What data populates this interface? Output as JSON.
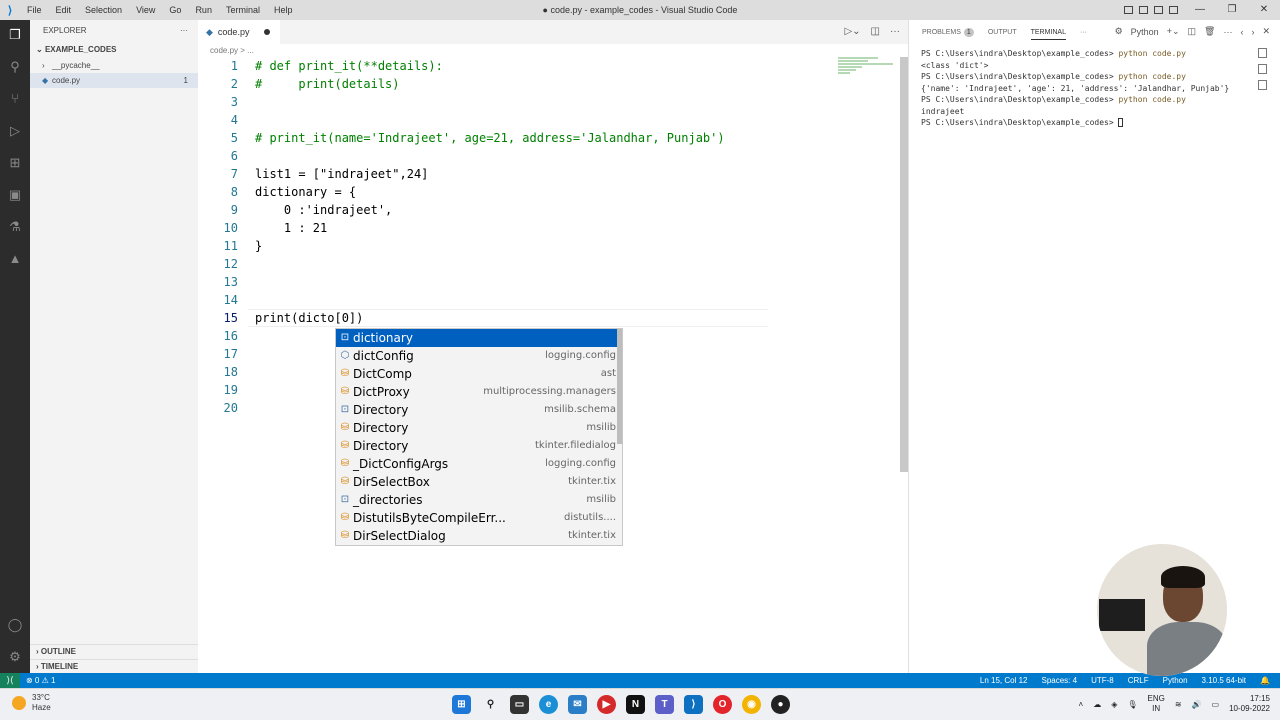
{
  "window": {
    "title": "● code.py - example_codes - Visual Studio Code",
    "menu": [
      "File",
      "Edit",
      "Selection",
      "View",
      "Go",
      "Run",
      "Terminal",
      "Help"
    ]
  },
  "sidebar": {
    "header": "EXPLORER",
    "folder": "EXAMPLE_CODES",
    "items": [
      {
        "label": "__pycache__",
        "type": "folder"
      },
      {
        "label": "code.py",
        "type": "file",
        "badge": "1"
      }
    ],
    "outline": "OUTLINE",
    "timeline": "TIMELINE"
  },
  "editor": {
    "tab": {
      "label": "code.py"
    },
    "breadcrumb": "code.py > ...",
    "lines": [
      {
        "n": "1",
        "t": "# def print_it(**details):"
      },
      {
        "n": "2",
        "t": "#     print(details)"
      },
      {
        "n": "3",
        "t": ""
      },
      {
        "n": "4",
        "t": ""
      },
      {
        "n": "5",
        "t": "# print_it(name='Indrajeet', age=21, address='Jalandhar, Punjab')"
      },
      {
        "n": "6",
        "t": ""
      },
      {
        "n": "7",
        "t": "list1 = [\"indrajeet\",24]"
      },
      {
        "n": "8",
        "t": "dictionary = {"
      },
      {
        "n": "9",
        "t": "    0 :'indrajeet',"
      },
      {
        "n": "10",
        "t": "    1 : 21"
      },
      {
        "n": "11",
        "t": "}"
      },
      {
        "n": "12",
        "t": ""
      },
      {
        "n": "13",
        "t": ""
      },
      {
        "n": "14",
        "t": ""
      },
      {
        "n": "15",
        "t": "print(dicto[0])"
      },
      {
        "n": "16",
        "t": ""
      },
      {
        "n": "17",
        "t": ""
      },
      {
        "n": "18",
        "t": ""
      },
      {
        "n": "19",
        "t": ""
      },
      {
        "n": "20",
        "t": ""
      }
    ]
  },
  "suggestions": [
    {
      "label": "dictionary",
      "detail": "",
      "icon": "variable-icon",
      "selected": true
    },
    {
      "label": "dictConfig",
      "detail": "logging.config",
      "icon": "function-icon"
    },
    {
      "label": "DictComp",
      "detail": "ast",
      "icon": "class-icon"
    },
    {
      "label": "DictProxy",
      "detail": "multiprocessing.managers",
      "icon": "class-icon"
    },
    {
      "label": "Directory",
      "detail": "msilib.schema",
      "icon": "variable-icon"
    },
    {
      "label": "Directory",
      "detail": "msilib",
      "icon": "class-icon"
    },
    {
      "label": "Directory",
      "detail": "tkinter.filedialog",
      "icon": "class-icon"
    },
    {
      "label": "_DictConfigArgs",
      "detail": "logging.config",
      "icon": "class-icon"
    },
    {
      "label": "DirSelectBox",
      "detail": "tkinter.tix",
      "icon": "class-icon"
    },
    {
      "label": "_directories",
      "detail": "msilib",
      "icon": "variable-icon"
    },
    {
      "label": "DistutilsByteCompileErr...",
      "detail": "distutils....",
      "icon": "class-icon"
    },
    {
      "label": "DirSelectDialog",
      "detail": "tkinter.tix",
      "icon": "class-icon"
    }
  ],
  "panel": {
    "tabs": {
      "problems": "PROBLEMS",
      "problems_count": "1",
      "output": "OUTPUT",
      "terminal": "TERMINAL"
    },
    "shell": "Python",
    "terminal_lines": [
      {
        "prompt": "PS C:\\Users\\indra\\Desktop\\example_codes>",
        "cmd": "python code.py"
      },
      {
        "out": "<class 'dict'>"
      },
      {
        "prompt": "PS C:\\Users\\indra\\Desktop\\example_codes>",
        "cmd": "python code.py"
      },
      {
        "out": "{'name': 'Indrajeet', 'age': 21, 'address': 'Jalandhar, Punjab'}"
      },
      {
        "prompt": "PS C:\\Users\\indra\\Desktop\\example_codes>",
        "cmd": "python code.py"
      },
      {
        "out": "indrajeet"
      },
      {
        "prompt": "PS C:\\Users\\indra\\Desktop\\example_codes>",
        "cmd": ""
      }
    ]
  },
  "statusbar": {
    "errors": "⊗ 0 ⚠ 1",
    "position": "Ln 15, Col 12",
    "spaces": "Spaces: 4",
    "encoding": "UTF-8",
    "eol": "CRLF",
    "language": "Python",
    "interpreter": "3.10.5 64-bit"
  },
  "taskbar": {
    "temperature": "33°C",
    "weather": "Haze",
    "lang": "ENG",
    "region": "IN",
    "time": "17:15",
    "date": "10-09-2022"
  }
}
